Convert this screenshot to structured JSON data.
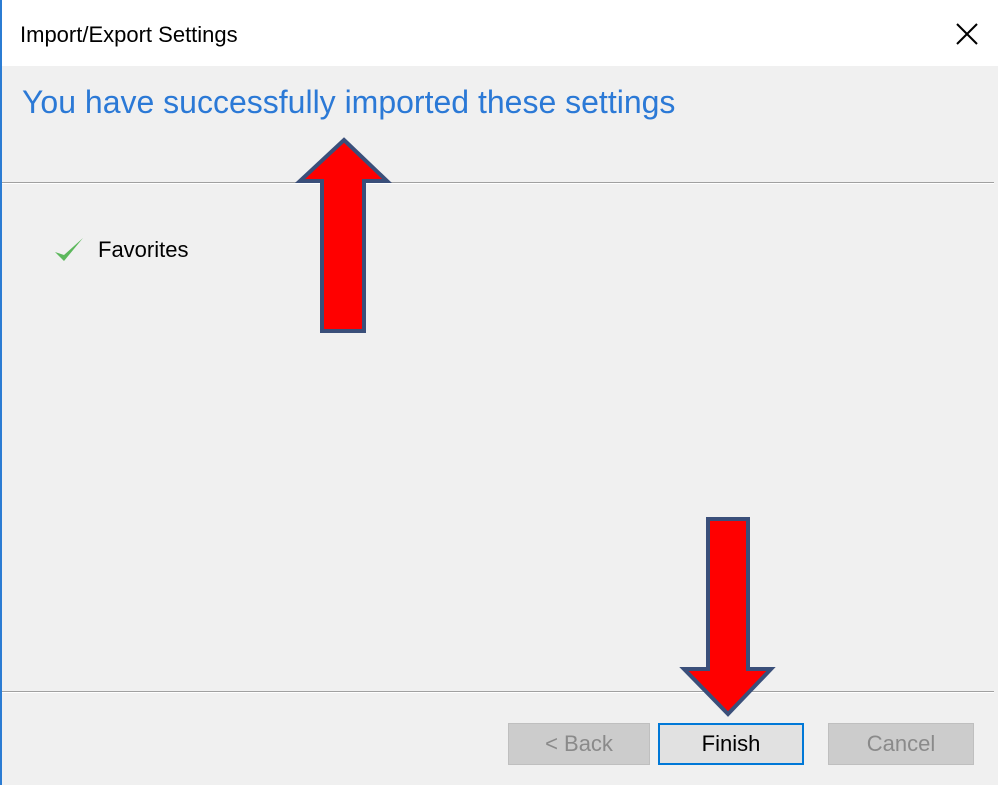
{
  "window": {
    "title": "Import/Export Settings"
  },
  "header": {
    "heading": "You have successfully imported these settings"
  },
  "items": [
    {
      "label": "Favorites",
      "icon": "checkmark-icon",
      "status": "success"
    }
  ],
  "buttons": {
    "back": "< Back",
    "finish": "Finish",
    "cancel": "Cancel"
  },
  "colors": {
    "accent": "#2b79d6",
    "arrow_fill": "#ff0000",
    "arrow_outline": "#3a4f7a",
    "check": "#5cb85c"
  }
}
